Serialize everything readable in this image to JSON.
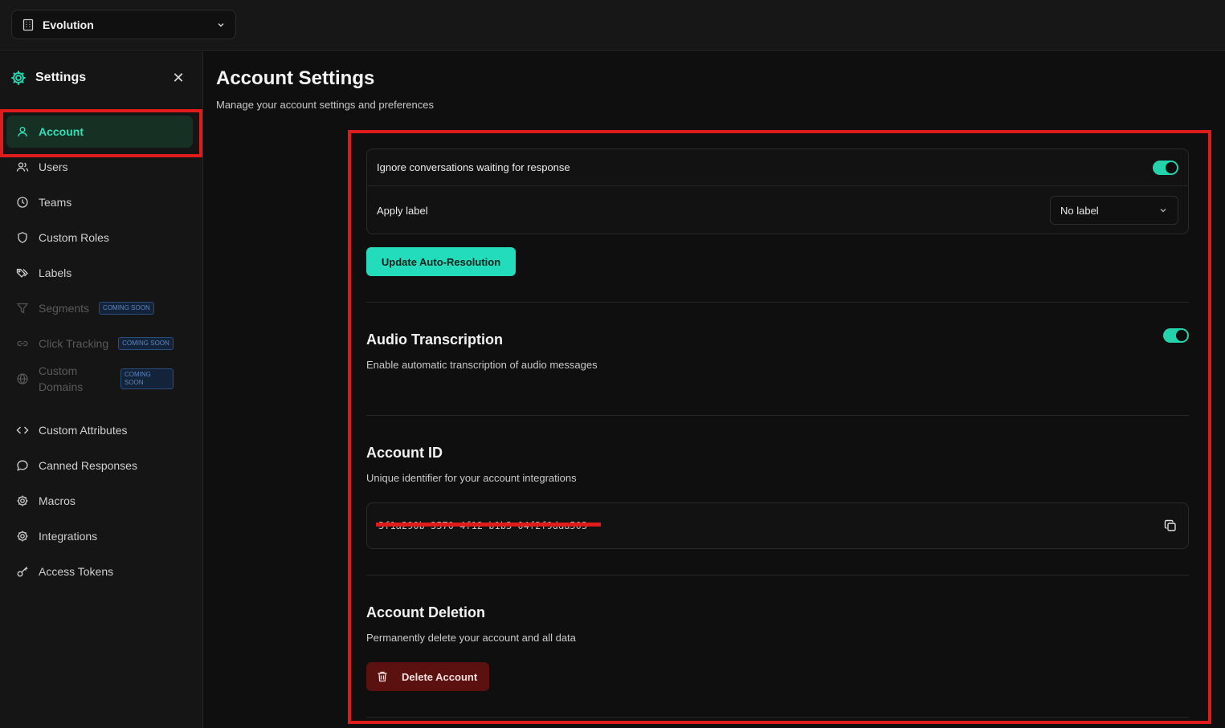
{
  "workspace": {
    "name": "Evolution"
  },
  "sidebar": {
    "title": "Settings",
    "items": [
      {
        "label": "Account",
        "icon": "user-icon",
        "state": "active"
      },
      {
        "label": "Users",
        "icon": "users-icon",
        "state": "normal"
      },
      {
        "label": "Teams",
        "icon": "clock-icon",
        "state": "normal"
      },
      {
        "label": "Custom Roles",
        "icon": "shield-icon",
        "state": "normal"
      },
      {
        "label": "Labels",
        "icon": "tags-icon",
        "state": "normal"
      },
      {
        "label": "Segments",
        "icon": "filter-icon",
        "state": "disabled",
        "badge": "COMING SOON"
      },
      {
        "label": "Click Tracking",
        "icon": "link-icon",
        "state": "disabled",
        "badge": "COMING SOON"
      },
      {
        "label": "Custom Domains",
        "icon": "globe-icon",
        "state": "disabled",
        "badge": "COMING SOON"
      },
      {
        "label": "Custom Attributes",
        "icon": "code-icon",
        "state": "normal"
      },
      {
        "label": "Canned Responses",
        "icon": "message-icon",
        "state": "normal"
      },
      {
        "label": "Macros",
        "icon": "gear-icon",
        "state": "normal"
      },
      {
        "label": "Integrations",
        "icon": "gear-icon",
        "state": "normal"
      },
      {
        "label": "Access Tokens",
        "icon": "key-icon",
        "state": "normal"
      }
    ]
  },
  "main": {
    "title": "Account Settings",
    "subtitle": "Manage your account settings and preferences",
    "auto_resolution": {
      "ignore_label": "Ignore conversations waiting for response",
      "ignore_enabled": true,
      "apply_label": "Apply label",
      "apply_value": "No label",
      "button": "Update Auto-Resolution"
    },
    "audio": {
      "title": "Audio Transcription",
      "description": "Enable automatic transcription of audio messages",
      "enabled": true
    },
    "account_id": {
      "title": "Account ID",
      "description": "Unique identifier for your account integrations",
      "value": "3f1a290b-3570-4f12-b1b3-04f2f9daa503"
    },
    "deletion": {
      "title": "Account Deletion",
      "description": "Permanently delete your account and all data",
      "button": "Delete Account"
    }
  },
  "colors": {
    "accent": "#22dcbb",
    "danger": "#5c1111",
    "highlight": "#e01b1b"
  }
}
